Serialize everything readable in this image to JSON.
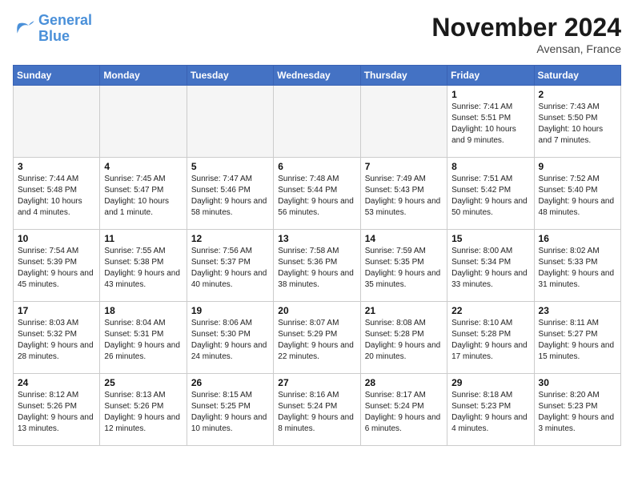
{
  "header": {
    "logo_line1": "General",
    "logo_line2": "Blue",
    "month_title": "November 2024",
    "location": "Avensan, France"
  },
  "weekdays": [
    "Sunday",
    "Monday",
    "Tuesday",
    "Wednesday",
    "Thursday",
    "Friday",
    "Saturday"
  ],
  "weeks": [
    [
      {
        "day": "",
        "info": ""
      },
      {
        "day": "",
        "info": ""
      },
      {
        "day": "",
        "info": ""
      },
      {
        "day": "",
        "info": ""
      },
      {
        "day": "",
        "info": ""
      },
      {
        "day": "1",
        "info": "Sunrise: 7:41 AM\nSunset: 5:51 PM\nDaylight: 10 hours and 9 minutes."
      },
      {
        "day": "2",
        "info": "Sunrise: 7:43 AM\nSunset: 5:50 PM\nDaylight: 10 hours and 7 minutes."
      }
    ],
    [
      {
        "day": "3",
        "info": "Sunrise: 7:44 AM\nSunset: 5:48 PM\nDaylight: 10 hours and 4 minutes."
      },
      {
        "day": "4",
        "info": "Sunrise: 7:45 AM\nSunset: 5:47 PM\nDaylight: 10 hours and 1 minute."
      },
      {
        "day": "5",
        "info": "Sunrise: 7:47 AM\nSunset: 5:46 PM\nDaylight: 9 hours and 58 minutes."
      },
      {
        "day": "6",
        "info": "Sunrise: 7:48 AM\nSunset: 5:44 PM\nDaylight: 9 hours and 56 minutes."
      },
      {
        "day": "7",
        "info": "Sunrise: 7:49 AM\nSunset: 5:43 PM\nDaylight: 9 hours and 53 minutes."
      },
      {
        "day": "8",
        "info": "Sunrise: 7:51 AM\nSunset: 5:42 PM\nDaylight: 9 hours and 50 minutes."
      },
      {
        "day": "9",
        "info": "Sunrise: 7:52 AM\nSunset: 5:40 PM\nDaylight: 9 hours and 48 minutes."
      }
    ],
    [
      {
        "day": "10",
        "info": "Sunrise: 7:54 AM\nSunset: 5:39 PM\nDaylight: 9 hours and 45 minutes."
      },
      {
        "day": "11",
        "info": "Sunrise: 7:55 AM\nSunset: 5:38 PM\nDaylight: 9 hours and 43 minutes."
      },
      {
        "day": "12",
        "info": "Sunrise: 7:56 AM\nSunset: 5:37 PM\nDaylight: 9 hours and 40 minutes."
      },
      {
        "day": "13",
        "info": "Sunrise: 7:58 AM\nSunset: 5:36 PM\nDaylight: 9 hours and 38 minutes."
      },
      {
        "day": "14",
        "info": "Sunrise: 7:59 AM\nSunset: 5:35 PM\nDaylight: 9 hours and 35 minutes."
      },
      {
        "day": "15",
        "info": "Sunrise: 8:00 AM\nSunset: 5:34 PM\nDaylight: 9 hours and 33 minutes."
      },
      {
        "day": "16",
        "info": "Sunrise: 8:02 AM\nSunset: 5:33 PM\nDaylight: 9 hours and 31 minutes."
      }
    ],
    [
      {
        "day": "17",
        "info": "Sunrise: 8:03 AM\nSunset: 5:32 PM\nDaylight: 9 hours and 28 minutes."
      },
      {
        "day": "18",
        "info": "Sunrise: 8:04 AM\nSunset: 5:31 PM\nDaylight: 9 hours and 26 minutes."
      },
      {
        "day": "19",
        "info": "Sunrise: 8:06 AM\nSunset: 5:30 PM\nDaylight: 9 hours and 24 minutes."
      },
      {
        "day": "20",
        "info": "Sunrise: 8:07 AM\nSunset: 5:29 PM\nDaylight: 9 hours and 22 minutes."
      },
      {
        "day": "21",
        "info": "Sunrise: 8:08 AM\nSunset: 5:28 PM\nDaylight: 9 hours and 20 minutes."
      },
      {
        "day": "22",
        "info": "Sunrise: 8:10 AM\nSunset: 5:28 PM\nDaylight: 9 hours and 17 minutes."
      },
      {
        "day": "23",
        "info": "Sunrise: 8:11 AM\nSunset: 5:27 PM\nDaylight: 9 hours and 15 minutes."
      }
    ],
    [
      {
        "day": "24",
        "info": "Sunrise: 8:12 AM\nSunset: 5:26 PM\nDaylight: 9 hours and 13 minutes."
      },
      {
        "day": "25",
        "info": "Sunrise: 8:13 AM\nSunset: 5:26 PM\nDaylight: 9 hours and 12 minutes."
      },
      {
        "day": "26",
        "info": "Sunrise: 8:15 AM\nSunset: 5:25 PM\nDaylight: 9 hours and 10 minutes."
      },
      {
        "day": "27",
        "info": "Sunrise: 8:16 AM\nSunset: 5:24 PM\nDaylight: 9 hours and 8 minutes."
      },
      {
        "day": "28",
        "info": "Sunrise: 8:17 AM\nSunset: 5:24 PM\nDaylight: 9 hours and 6 minutes."
      },
      {
        "day": "29",
        "info": "Sunrise: 8:18 AM\nSunset: 5:23 PM\nDaylight: 9 hours and 4 minutes."
      },
      {
        "day": "30",
        "info": "Sunrise: 8:20 AM\nSunset: 5:23 PM\nDaylight: 9 hours and 3 minutes."
      }
    ]
  ]
}
